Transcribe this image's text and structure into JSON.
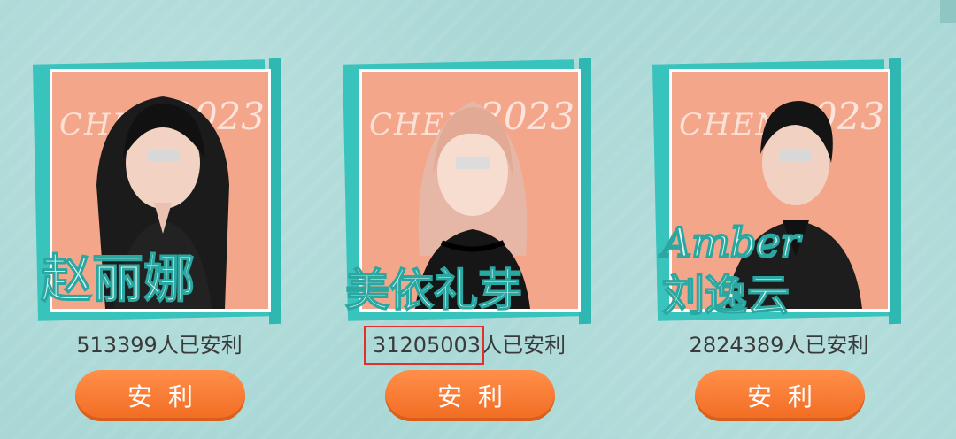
{
  "cards": [
    {
      "watermark": "CHENG",
      "year": "2023",
      "signature_lines": [
        "赵丽娜"
      ],
      "count": "513399",
      "count_suffix": "人已安利",
      "button_label": "安利",
      "highlighted": false
    },
    {
      "watermark": "CHENG",
      "year": "2023",
      "signature_lines": [
        "美依礼芽"
      ],
      "count": "31205003",
      "count_suffix": "人已安利",
      "button_label": "安利",
      "highlighted": true
    },
    {
      "watermark": "CHENG",
      "year": "2023",
      "signature_lines": [
        "Amber",
        "刘逸云"
      ],
      "count": "2824389",
      "count_suffix": "人已安利",
      "button_label": "安利",
      "highlighted": false
    }
  ],
  "colors": {
    "background": "#a9d8d6",
    "frame_teal": "#38c3bc",
    "frame_salmon": "#f4a68a",
    "button_orange": "#f26b22",
    "highlight_red": "#e0302a"
  }
}
